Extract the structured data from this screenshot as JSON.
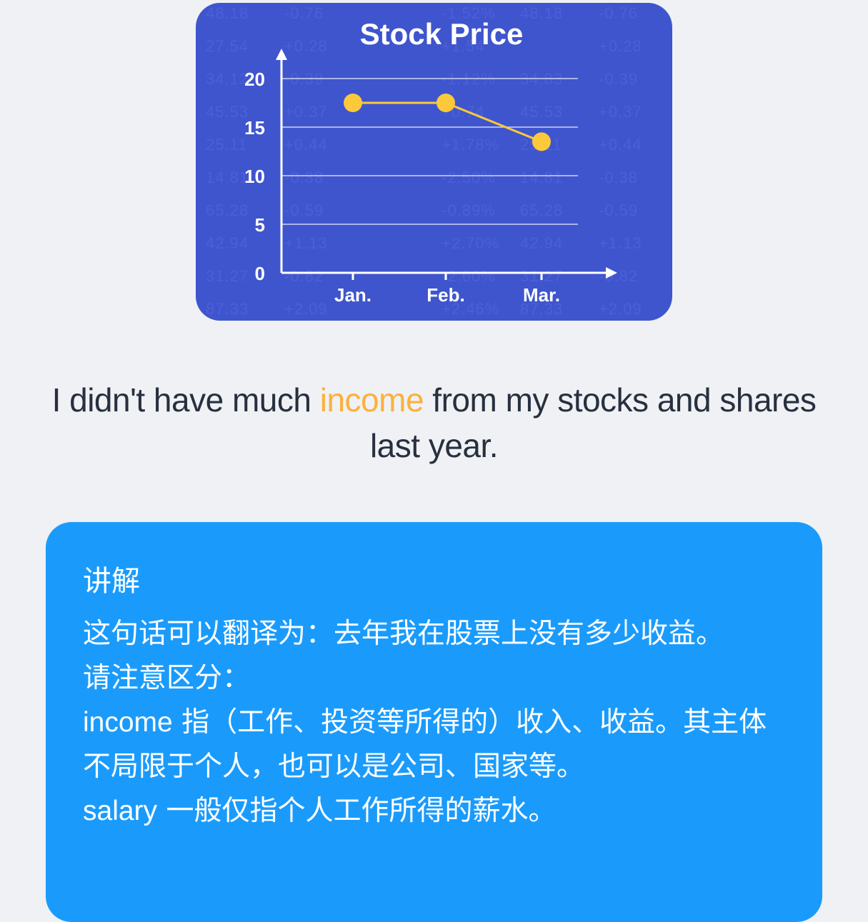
{
  "chart_data": {
    "type": "line",
    "title": "Stock Price",
    "categories": [
      "Jan.",
      "Feb.",
      "Mar."
    ],
    "values": [
      17.5,
      17.5,
      13.5
    ],
    "yticks": [
      0,
      5,
      10,
      15,
      20
    ],
    "ylim": [
      0,
      20
    ],
    "grid": true,
    "colors": {
      "background": "#3f55cd",
      "line": "#fcc93a",
      "axis": "#ffffff"
    }
  },
  "ticker": [
    [
      "48.18",
      "-0.76",
      "",
      "-1.52%",
      "48.18",
      "-0.76"
    ],
    [
      "27.54",
      "+0.28",
      "",
      "+1.54",
      "",
      "+0.28"
    ],
    [
      "34.12",
      "-0.39",
      "",
      "-1.12%",
      "34.83",
      "-0.39"
    ],
    [
      "45.53",
      "+0.37",
      "",
      "+0.74",
      "45.53",
      "+0.37"
    ],
    [
      "25.11",
      "+0.44",
      "",
      "+1.78%",
      "25.11",
      "+0.44"
    ],
    [
      "14.81",
      "-0.38",
      "",
      "-2.50%",
      "14.81",
      "-0.38"
    ],
    [
      "65.28",
      "-0.59",
      "",
      "-0.89%",
      "65.28",
      "-0.59"
    ],
    [
      "42.94",
      "+1.13",
      "",
      "+2.70%",
      "42.94",
      "+1.13"
    ],
    [
      "31.27",
      "-0.82",
      "",
      "-2.60%",
      "31.27",
      "-0.82"
    ],
    [
      "87.33",
      "+2.09",
      "",
      "+2.46%",
      "87.33",
      "+2.09"
    ]
  ],
  "sentence": {
    "before": "I didn't have much ",
    "highlight": "income",
    "after": " from my stocks and shares last year."
  },
  "explanation": {
    "title": "讲解",
    "line1": "这句话可以翻译为：去年我在股票上没有多少收益。",
    "line2": "请注意区分：",
    "income_word": "income",
    "income_def": " 指（工作、投资等所得的）收入、收益。其主体不局限于个人，也可以是公司、国家等。",
    "salary_word": "salary",
    "salary_def": " 一般仅指个人工作所得的薪水。"
  },
  "colors": {
    "page_bg": "#eff1f4",
    "highlight": "#fbb13c",
    "card_bg": "#1a9bfc",
    "text_dark": "#27303f"
  }
}
